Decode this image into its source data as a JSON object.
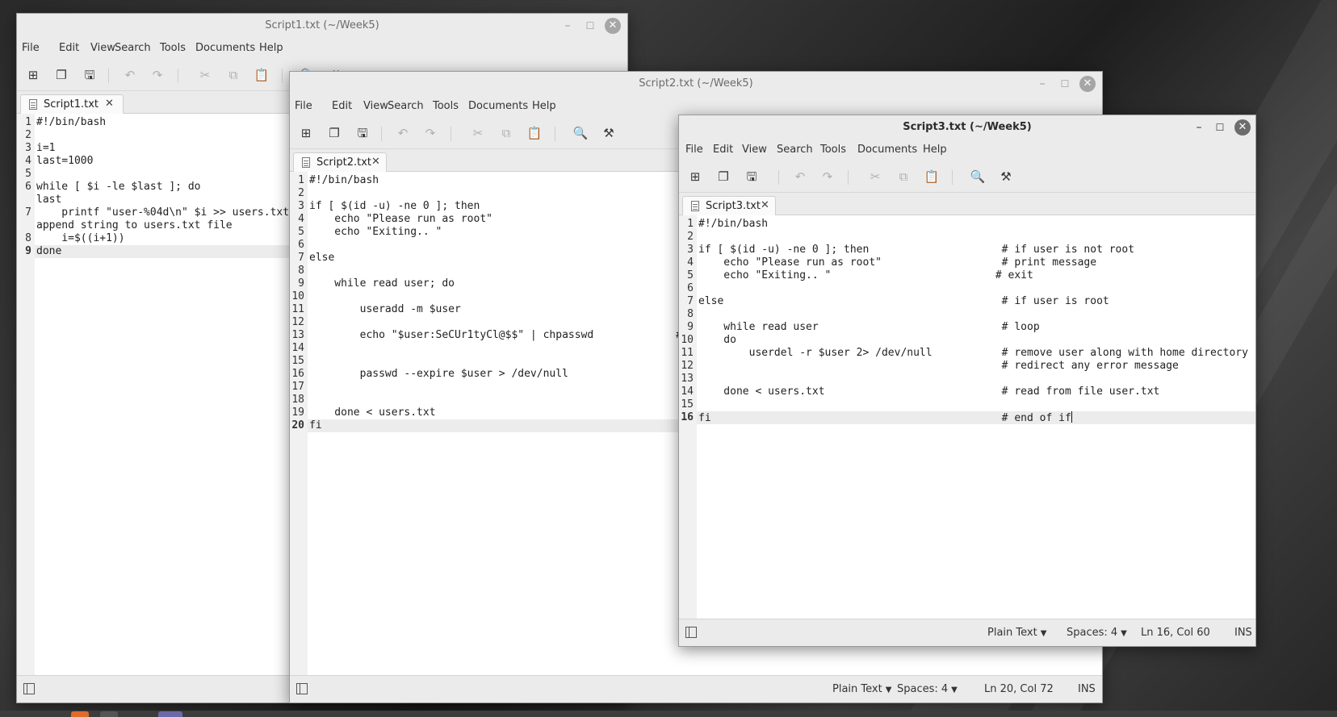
{
  "colors": {
    "highlight_line": "#ececec",
    "window_chrome": "#ebebeb",
    "editor_bg": "#ffffff"
  },
  "menus": [
    "File",
    "Edit",
    "View",
    "Search",
    "Tools",
    "Documents",
    "Help"
  ],
  "toolbar_icons": [
    "new-document-icon",
    "open-document-icon",
    "save-icon",
    "undo-icon",
    "redo-icon",
    "cut-icon",
    "copy-icon",
    "paste-icon",
    "search-icon",
    "replace-icon"
  ],
  "windows": {
    "w1": {
      "title": "Script1.txt (~/Week5)",
      "tab_label": "Script1.txt",
      "lines": [
        {
          "num": "1",
          "text": "#!/bin/bash"
        },
        {
          "num": "2",
          "text": ""
        },
        {
          "num": "3",
          "text": "i=1"
        },
        {
          "num": "4",
          "text": "last=1000"
        },
        {
          "num": "5",
          "text": ""
        },
        {
          "num": "6",
          "text": "while [ $i -le $last ]; do"
        },
        {
          "num": "",
          "text": "last"
        },
        {
          "num": "7",
          "text": "    printf \"user-%04d\\n\" $i >> users.txt"
        },
        {
          "num": "",
          "text": "append string to users.txt file"
        },
        {
          "num": "8",
          "text": "    i=$((i+1))"
        },
        {
          "num": "9",
          "text": "done"
        }
      ]
    },
    "w2": {
      "title": "Script2.txt (~/Week5)",
      "tab_label": "Script2.txt",
      "lines": [
        {
          "num": "1",
          "text": "#!/bin/bash"
        },
        {
          "num": "2",
          "text": ""
        },
        {
          "num": "3",
          "text": "if [ $(id -u) -ne 0 ]; then"
        },
        {
          "num": "4",
          "text": "    echo \"Please run as root\""
        },
        {
          "num": "5",
          "text": "    echo \"Exiting.. \""
        },
        {
          "num": "6",
          "text": ""
        },
        {
          "num": "7",
          "text": "else"
        },
        {
          "num": "8",
          "text": ""
        },
        {
          "num": "9",
          "text": "    while read user; do"
        },
        {
          "num": "10",
          "text": ""
        },
        {
          "num": "11",
          "text": "        useradd -m $user"
        },
        {
          "num": "12",
          "text": ""
        },
        {
          "num": "13",
          "text": "        echo \"$user:SeCUr1tyCl@$$\" | chpasswd             # "
        },
        {
          "num": "14",
          "text": ""
        },
        {
          "num": "15",
          "text": ""
        },
        {
          "num": "16",
          "text": "        passwd --expire $user > /dev/null"
        },
        {
          "num": "17",
          "text": ""
        },
        {
          "num": "18",
          "text": ""
        },
        {
          "num": "19",
          "text": "    done < users.txt"
        },
        {
          "num": "20",
          "text": "fi"
        }
      ],
      "status": {
        "language": "Plain Text",
        "spaces": "Spaces: 4",
        "position": "Ln 20, Col 72",
        "mode": "INS"
      }
    },
    "w3": {
      "title": "Script3.txt (~/Week5)",
      "tab_label": "Script3.txt",
      "lines": [
        {
          "num": "1",
          "text": "#!/bin/bash"
        },
        {
          "num": "2",
          "text": ""
        },
        {
          "num": "3",
          "text": "if [ $(id -u) -ne 0 ]; then                     # if user is not root"
        },
        {
          "num": "4",
          "text": "    echo \"Please run as root\"                   # print message"
        },
        {
          "num": "5",
          "text": "    echo \"Exiting.. \"                          # exit"
        },
        {
          "num": "6",
          "text": ""
        },
        {
          "num": "7",
          "text": "else                                            # if user is root"
        },
        {
          "num": "8",
          "text": ""
        },
        {
          "num": "9",
          "text": "    while read user                             # loop"
        },
        {
          "num": "10",
          "text": "    do"
        },
        {
          "num": "11",
          "text": "        userdel -r $user 2> /dev/null           # remove user along with home directory"
        },
        {
          "num": "12",
          "text": "                                                # redirect any error message"
        },
        {
          "num": "13",
          "text": ""
        },
        {
          "num": "14",
          "text": "    done < users.txt                            # read from file user.txt"
        },
        {
          "num": "15",
          "text": ""
        },
        {
          "num": "16",
          "text": "fi                                              # end of if"
        }
      ],
      "status": {
        "language": "Plain Text",
        "spaces": "Spaces: 4",
        "position": "Ln 16, Col 60",
        "mode": "INS"
      }
    }
  }
}
